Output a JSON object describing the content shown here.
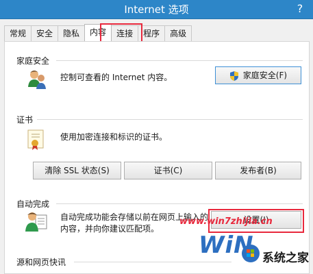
{
  "window": {
    "title": "Internet 选项",
    "help_glyph": "?"
  },
  "tabs": [
    {
      "label": "常规",
      "active": false
    },
    {
      "label": "安全",
      "active": false
    },
    {
      "label": "隐私",
      "active": false
    },
    {
      "label": "内容",
      "active": true
    },
    {
      "label": "连接",
      "active": false
    },
    {
      "label": "程序",
      "active": false
    },
    {
      "label": "高级",
      "active": false
    }
  ],
  "family_safety": {
    "title": "家庭安全",
    "description": "控制可查看的 Internet 内容。",
    "button_label": "家庭安全(F)",
    "icon": "family-users-icon",
    "button_icon": "uac-shield-icon"
  },
  "certificates": {
    "title": "证书",
    "description": "使用加密连接和标识的证书。",
    "icon": "certificate-icon",
    "buttons": {
      "clear_ssl": "清除 SSL 状态(S)",
      "certificates": "证书(C)",
      "publishers": "发布者(B)"
    }
  },
  "autocomplete": {
    "title": "自动完成",
    "description_line1": "自动完成功能会存储以前在网页上输入的",
    "description_line2": "内容，并向你建议匹配项。",
    "button_label": "设置(I)",
    "icon": "autocomplete-icon"
  },
  "feeds": {
    "title": "源和网页快讯"
  },
  "watermark": {
    "url": "www.win7zhijia.cn",
    "brand": "系统之家",
    "logo_letters": "WiN"
  },
  "colors": {
    "titlebar": "#2d86c8",
    "highlight": "#e8283c",
    "dialog_bg": "#f0f0f0"
  }
}
